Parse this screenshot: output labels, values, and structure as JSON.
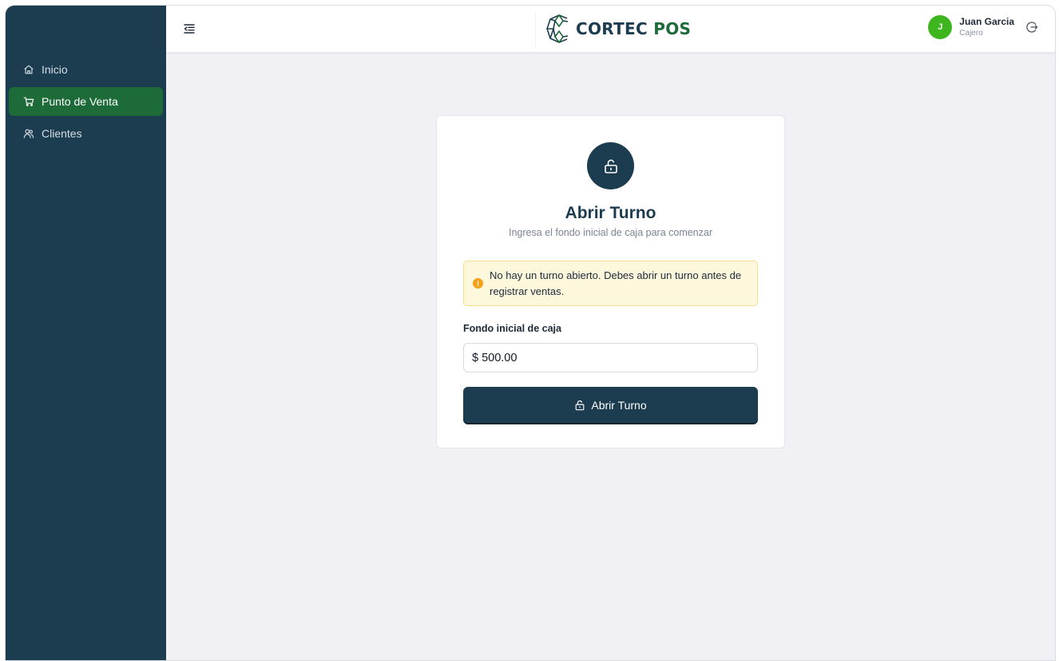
{
  "sidebar": {
    "items": [
      {
        "label": "Inicio",
        "icon": "home-icon",
        "active": false
      },
      {
        "label": "Punto de Venta",
        "icon": "cart-icon",
        "active": true
      },
      {
        "label": "Clientes",
        "icon": "users-icon",
        "active": false
      }
    ],
    "colors": {
      "background": "#1c3c50",
      "active": "#1e6b3a"
    }
  },
  "header": {
    "brand": {
      "part1": "CORTEC",
      "part2": "POS"
    },
    "user": {
      "initial": "J",
      "name": "Juan Garcia",
      "role": "Cajero"
    },
    "icons": {
      "menu": "menu-collapse-icon",
      "logout": "logout-icon"
    }
  },
  "shift": {
    "icon": "unlock-icon",
    "title": "Abrir Turno",
    "subtitle": "Ingresa el fondo inicial de caja para comenzar",
    "alert": {
      "icon": "warning-icon",
      "symbol": "!",
      "text": "No hay un turno abierto. Debes abrir un turno antes de registrar ventas."
    },
    "field_label": "Fondo inicial de caja",
    "currency": "$",
    "amount": "500.00",
    "button_label": "Abrir Turno"
  }
}
